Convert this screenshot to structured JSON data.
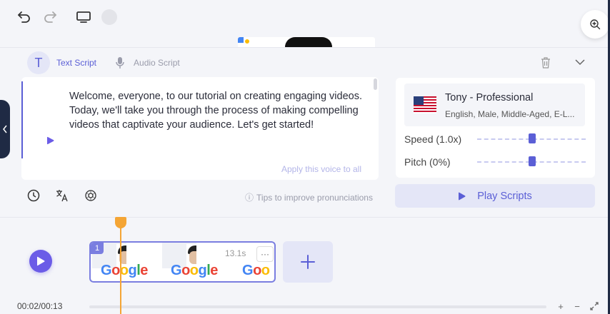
{
  "topbar": {
    "undo_icon": "undo-icon",
    "redo_icon": "redo-icon",
    "monitor_icon": "monitor-icon",
    "zoom_icon": "zoom-in-icon"
  },
  "script_tabs": {
    "text_icon_glyph": "T",
    "text_label": "Text Script",
    "audio_label": "Audio Script"
  },
  "script": {
    "text": "Welcome, everyone, to our tutorial on creating engaging videos. Today, we'll take you through the process of making compelling videos that captivate your audience. Let's get started!",
    "apply_voice": "Apply this voice to all",
    "tips": "Tips to improve pronunciations",
    "tips_glyph": "ⓘ"
  },
  "voice": {
    "name": "Tony - Professional",
    "description": "English, Male, Middle-Aged, E-L...",
    "speed_label": "Speed (1.0x)",
    "speed_value": 1.0,
    "pitch_label": "Pitch (0%)",
    "pitch_value": 0,
    "play_scripts": "Play Scripts"
  },
  "timeline": {
    "clip_number": "1",
    "clip_duration": "13.1s",
    "clip_logo_text": "Google",
    "more_glyph": "···",
    "current_time": "00:02/00:13",
    "zoom_in": "+",
    "zoom_out": "−"
  },
  "colors": {
    "accent": "#5b5fd6",
    "playhead": "#f4a535",
    "panel": "#f4f5f9"
  }
}
